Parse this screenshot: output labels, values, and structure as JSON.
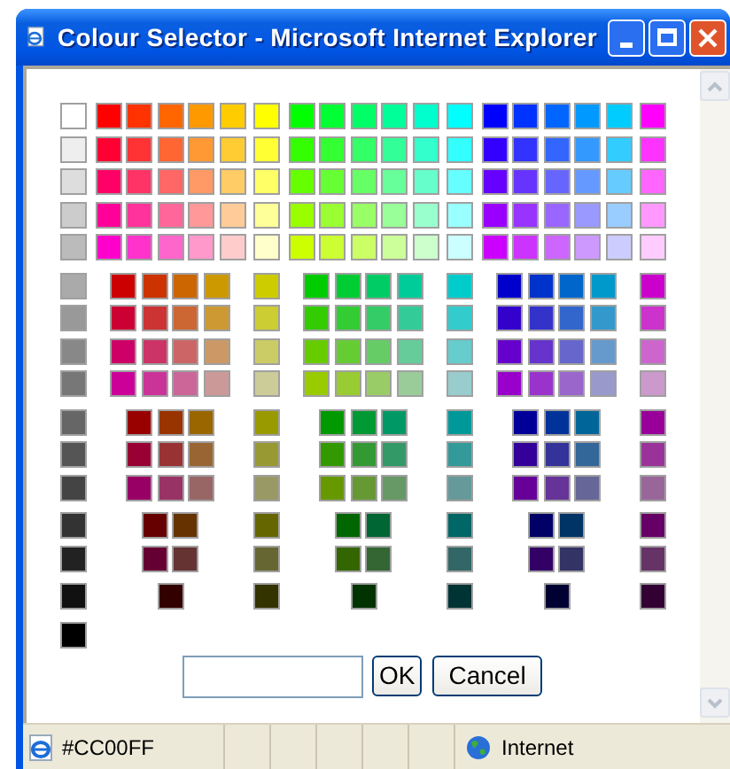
{
  "window": {
    "title": "Colour Selector - Microsoft Internet Explorer"
  },
  "swatch_blocks": [
    {
      "rows": [
        [
          [
            {
              "color": "#ffffff"
            }
          ],
          [
            {
              "color": "#ff0000"
            },
            {
              "color": "#ff3300"
            },
            {
              "color": "#ff6600"
            },
            {
              "color": "#ff9900"
            },
            {
              "color": "#ffcc00"
            }
          ],
          [
            {
              "color": "#ffff00"
            }
          ],
          [
            {
              "color": "#00ff00"
            },
            {
              "color": "#00ff33"
            },
            {
              "color": "#00ff66"
            },
            {
              "color": "#00ff99"
            },
            {
              "color": "#00ffcc"
            }
          ],
          [
            {
              "color": "#00ffff"
            }
          ],
          [
            {
              "color": "#0000ff"
            },
            {
              "color": "#0033ff"
            },
            {
              "color": "#0066ff"
            },
            {
              "color": "#0099ff"
            },
            {
              "color": "#00ccff"
            }
          ],
          [
            {
              "color": "#ff00ff"
            }
          ]
        ],
        [
          [
            {
              "color": "#eeeeee"
            }
          ],
          [
            {
              "color": "#ff0033"
            },
            {
              "color": "#ff3333"
            },
            {
              "color": "#ff6633"
            },
            {
              "color": "#ff9933"
            },
            {
              "color": "#ffcc33"
            }
          ],
          [
            {
              "color": "#ffff33"
            }
          ],
          [
            {
              "color": "#33ff00"
            },
            {
              "color": "#33ff33"
            },
            {
              "color": "#33ff66"
            },
            {
              "color": "#33ff99"
            },
            {
              "color": "#33ffcc"
            }
          ],
          [
            {
              "color": "#33ffff"
            }
          ],
          [
            {
              "color": "#3300ff"
            },
            {
              "color": "#3333ff"
            },
            {
              "color": "#3366ff"
            },
            {
              "color": "#3399ff"
            },
            {
              "color": "#33ccff"
            }
          ],
          [
            {
              "color": "#ff33ff"
            }
          ]
        ],
        [
          [
            {
              "color": "#dddddd"
            }
          ],
          [
            {
              "color": "#ff0066"
            },
            {
              "color": "#ff3366"
            },
            {
              "color": "#ff6666"
            },
            {
              "color": "#ff9966"
            },
            {
              "color": "#ffcc66"
            }
          ],
          [
            {
              "color": "#ffff66"
            }
          ],
          [
            {
              "color": "#66ff00"
            },
            {
              "color": "#66ff33"
            },
            {
              "color": "#66ff66"
            },
            {
              "color": "#66ff99"
            },
            {
              "color": "#66ffcc"
            }
          ],
          [
            {
              "color": "#66ffff"
            }
          ],
          [
            {
              "color": "#6600ff"
            },
            {
              "color": "#6633ff"
            },
            {
              "color": "#6666ff"
            },
            {
              "color": "#6699ff"
            },
            {
              "color": "#66ccff"
            }
          ],
          [
            {
              "color": "#ff66ff"
            }
          ]
        ],
        [
          [
            {
              "color": "#cccccc"
            }
          ],
          [
            {
              "color": "#ff0099"
            },
            {
              "color": "#ff3399"
            },
            {
              "color": "#ff6699"
            },
            {
              "color": "#ff9999"
            },
            {
              "color": "#ffcc99"
            }
          ],
          [
            {
              "color": "#ffff99"
            }
          ],
          [
            {
              "color": "#99ff00"
            },
            {
              "color": "#99ff33"
            },
            {
              "color": "#99ff66"
            },
            {
              "color": "#99ff99"
            },
            {
              "color": "#99ffcc"
            }
          ],
          [
            {
              "color": "#99ffff"
            }
          ],
          [
            {
              "color": "#9900ff"
            },
            {
              "color": "#9933ff"
            },
            {
              "color": "#9966ff"
            },
            {
              "color": "#9999ff"
            },
            {
              "color": "#99ccff"
            }
          ],
          [
            {
              "color": "#ff99ff"
            }
          ]
        ],
        [
          [
            {
              "color": "#bbbbbb"
            }
          ],
          [
            {
              "color": "#ff00cc"
            },
            {
              "color": "#ff33cc"
            },
            {
              "color": "#ff66cc"
            },
            {
              "color": "#ff99cc"
            },
            {
              "color": "#ffcccc"
            }
          ],
          [
            {
              "color": "#ffffcc"
            }
          ],
          [
            {
              "color": "#ccff00"
            },
            {
              "color": "#ccff33"
            },
            {
              "color": "#ccff66"
            },
            {
              "color": "#ccff99"
            },
            {
              "color": "#ccffcc"
            }
          ],
          [
            {
              "color": "#ccffff"
            }
          ],
          [
            {
              "color": "#cc00ff"
            },
            {
              "color": "#cc33ff"
            },
            {
              "color": "#cc66ff"
            },
            {
              "color": "#cc99ff"
            },
            {
              "color": "#ccccff"
            }
          ],
          [
            {
              "color": "#ffccff"
            }
          ]
        ]
      ]
    },
    {
      "rows": [
        [
          [
            {
              "color": "#aaaaaa"
            }
          ],
          [
            {
              "color": "#cc0000"
            },
            {
              "color": "#cc3300"
            },
            {
              "color": "#cc6600"
            },
            {
              "color": "#cc9900"
            }
          ],
          [
            {
              "color": "#cccc00"
            }
          ],
          [
            {
              "color": "#00cc00"
            },
            {
              "color": "#00cc33"
            },
            {
              "color": "#00cc66"
            },
            {
              "color": "#00cc99"
            }
          ],
          [
            {
              "color": "#00cccc"
            }
          ],
          [
            {
              "color": "#0000cc"
            },
            {
              "color": "#0033cc"
            },
            {
              "color": "#0066cc"
            },
            {
              "color": "#0099cc"
            }
          ],
          [
            {
              "color": "#cc00cc"
            }
          ]
        ],
        [
          [
            {
              "color": "#999999"
            }
          ],
          [
            {
              "color": "#cc0033"
            },
            {
              "color": "#cc3333"
            },
            {
              "color": "#cc6633"
            },
            {
              "color": "#cc9933"
            }
          ],
          [
            {
              "color": "#cccc33"
            }
          ],
          [
            {
              "color": "#33cc00"
            },
            {
              "color": "#33cc33"
            },
            {
              "color": "#33cc66"
            },
            {
              "color": "#33cc99"
            }
          ],
          [
            {
              "color": "#33cccc"
            }
          ],
          [
            {
              "color": "#3300cc"
            },
            {
              "color": "#3333cc"
            },
            {
              "color": "#3366cc"
            },
            {
              "color": "#3399cc"
            }
          ],
          [
            {
              "color": "#cc33cc"
            }
          ]
        ],
        [
          [
            {
              "color": "#888888"
            }
          ],
          [
            {
              "color": "#cc0066"
            },
            {
              "color": "#cc3366"
            },
            {
              "color": "#cc6666"
            },
            {
              "color": "#cc9966"
            }
          ],
          [
            {
              "color": "#cccc66"
            }
          ],
          [
            {
              "color": "#66cc00"
            },
            {
              "color": "#66cc33"
            },
            {
              "color": "#66cc66"
            },
            {
              "color": "#66cc99"
            }
          ],
          [
            {
              "color": "#66cccc"
            }
          ],
          [
            {
              "color": "#6600cc"
            },
            {
              "color": "#6633cc"
            },
            {
              "color": "#6666cc"
            },
            {
              "color": "#6699cc"
            }
          ],
          [
            {
              "color": "#cc66cc"
            }
          ]
        ],
        [
          [
            {
              "color": "#777777"
            }
          ],
          [
            {
              "color": "#cc0099"
            },
            {
              "color": "#cc3399"
            },
            {
              "color": "#cc6699"
            },
            {
              "color": "#cc9999"
            }
          ],
          [
            {
              "color": "#cccc99"
            }
          ],
          [
            {
              "color": "#99cc00"
            },
            {
              "color": "#99cc33"
            },
            {
              "color": "#99cc66"
            },
            {
              "color": "#99cc99"
            }
          ],
          [
            {
              "color": "#99cccc"
            }
          ],
          [
            {
              "color": "#9900cc"
            },
            {
              "color": "#9933cc"
            },
            {
              "color": "#9966cc"
            },
            {
              "color": "#9999cc"
            }
          ],
          [
            {
              "color": "#cc99cc"
            }
          ]
        ]
      ]
    },
    {
      "rows": [
        [
          [
            {
              "color": "#666666"
            }
          ],
          [
            {
              "color": "#990000"
            },
            {
              "color": "#993300"
            },
            {
              "color": "#996600"
            }
          ],
          [
            {
              "color": "#999900"
            }
          ],
          [
            {
              "color": "#009900"
            },
            {
              "color": "#009933"
            },
            {
              "color": "#009966"
            }
          ],
          [
            {
              "color": "#009999"
            }
          ],
          [
            {
              "color": "#000099"
            },
            {
              "color": "#003399"
            },
            {
              "color": "#006699"
            }
          ],
          [
            {
              "color": "#990099"
            }
          ]
        ],
        [
          [
            {
              "color": "#555555"
            }
          ],
          [
            {
              "color": "#990033"
            },
            {
              "color": "#993333"
            },
            {
              "color": "#996633"
            }
          ],
          [
            {
              "color": "#999933"
            }
          ],
          [
            {
              "color": "#339900"
            },
            {
              "color": "#339933"
            },
            {
              "color": "#339966"
            }
          ],
          [
            {
              "color": "#339999"
            }
          ],
          [
            {
              "color": "#330099"
            },
            {
              "color": "#333399"
            },
            {
              "color": "#336699"
            }
          ],
          [
            {
              "color": "#993399"
            }
          ]
        ],
        [
          [
            {
              "color": "#444444"
            }
          ],
          [
            {
              "color": "#990066"
            },
            {
              "color": "#993366"
            },
            {
              "color": "#996666"
            }
          ],
          [
            {
              "color": "#999966"
            }
          ],
          [
            {
              "color": "#669900"
            },
            {
              "color": "#669933"
            },
            {
              "color": "#669966"
            }
          ],
          [
            {
              "color": "#669999"
            }
          ],
          [
            {
              "color": "#660099"
            },
            {
              "color": "#663399"
            },
            {
              "color": "#666699"
            }
          ],
          [
            {
              "color": "#996699"
            }
          ]
        ]
      ]
    },
    {
      "rows": [
        [
          [
            {
              "color": "#333333"
            }
          ],
          [
            {
              "color": "#660000"
            },
            {
              "color": "#663300"
            }
          ],
          [
            {
              "color": "#666600"
            }
          ],
          [
            {
              "color": "#006600"
            },
            {
              "color": "#006633"
            }
          ],
          [
            {
              "color": "#006666"
            }
          ],
          [
            {
              "color": "#000066"
            },
            {
              "color": "#003366"
            }
          ],
          [
            {
              "color": "#660066"
            }
          ]
        ],
        [
          [
            {
              "color": "#222222"
            }
          ],
          [
            {
              "color": "#660033"
            },
            {
              "color": "#663333"
            }
          ],
          [
            {
              "color": "#666633"
            }
          ],
          [
            {
              "color": "#336600"
            },
            {
              "color": "#336633"
            }
          ],
          [
            {
              "color": "#336666"
            }
          ],
          [
            {
              "color": "#330066"
            },
            {
              "color": "#333366"
            }
          ],
          [
            {
              "color": "#663366"
            }
          ]
        ]
      ]
    },
    {
      "rows": [
        [
          [
            {
              "color": "#111111"
            }
          ],
          [
            {
              "color": "#330000"
            }
          ],
          [
            {
              "color": "#333300"
            }
          ],
          [
            {
              "color": "#003300"
            }
          ],
          [
            {
              "color": "#003333"
            }
          ],
          [
            {
              "color": "#000033"
            }
          ],
          [
            {
              "color": "#330033"
            }
          ]
        ]
      ]
    },
    {
      "rows": [
        [
          [
            {
              "color": "#000000"
            }
          ]
        ]
      ]
    }
  ],
  "buttons": [
    "OK",
    "Cancel"
  ],
  "status_bar": {
    "text": "#CC00FF",
    "zone": "Internet"
  }
}
